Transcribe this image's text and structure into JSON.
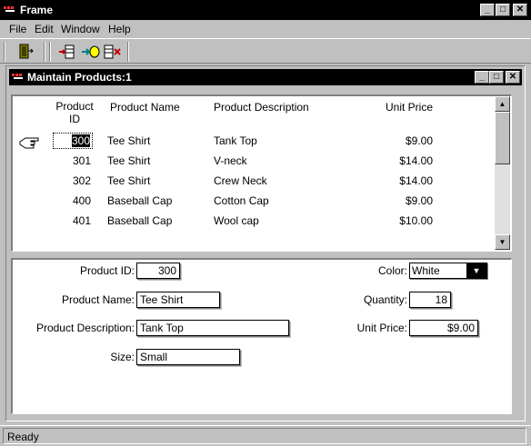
{
  "window": {
    "title": "Frame"
  },
  "menu": [
    {
      "label": "File"
    },
    {
      "label": "Edit"
    },
    {
      "label": "Window"
    },
    {
      "label": "Help"
    }
  ],
  "child": {
    "title": "Maintain Products:1"
  },
  "grid": {
    "headers": {
      "id_line1": "Product",
      "id_line2": "ID",
      "name": "Product Name",
      "desc": "Product Description",
      "price": "Unit Price"
    },
    "rows": [
      {
        "id": "300",
        "name": "Tee Shirt",
        "desc": "Tank Top",
        "price": "$9.00"
      },
      {
        "id": "301",
        "name": "Tee Shirt",
        "desc": "V-neck",
        "price": "$14.00"
      },
      {
        "id": "302",
        "name": "Tee Shirt",
        "desc": "Crew Neck",
        "price": "$14.00"
      },
      {
        "id": "400",
        "name": "Baseball Cap",
        "desc": "Cotton Cap",
        "price": "$9.00"
      },
      {
        "id": "401",
        "name": "Baseball Cap",
        "desc": "Wool cap",
        "price": "$10.00"
      }
    ]
  },
  "form": {
    "product_id_label": "Product ID:",
    "product_id": "300",
    "product_name_label": "Product Name:",
    "product_name": "Tee Shirt",
    "product_desc_label": "Product Description:",
    "product_desc": "Tank Top",
    "size_label": "Size:",
    "size": "Small",
    "color_label": "Color:",
    "color": "White",
    "quantity_label": "Quantity:",
    "quantity": "18",
    "unit_price_label": "Unit Price:",
    "unit_price": "$9.00"
  },
  "status": {
    "text": "Ready"
  },
  "icons": {
    "app": "app-icon",
    "exit": "exit-door-icon",
    "insert_row": "insert-row-icon",
    "retrieve": "retrieve-icon",
    "delete_row": "delete-row-icon",
    "pointer": "pointing-hand-icon"
  }
}
